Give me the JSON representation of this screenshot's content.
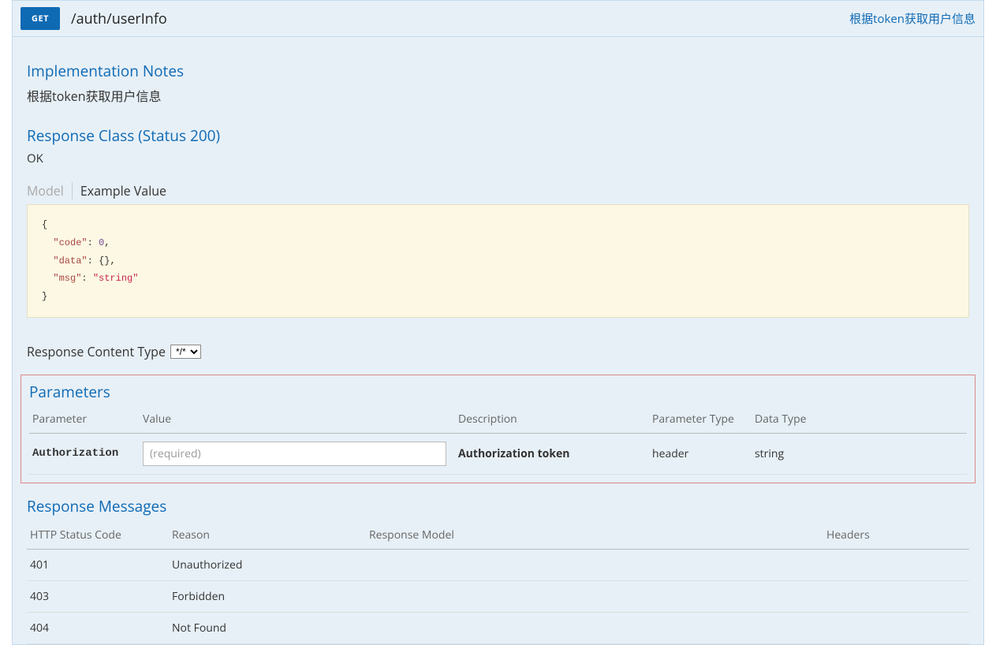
{
  "operation": {
    "method": "GET",
    "path": "/auth/userInfo",
    "summary": "根据token获取用户信息"
  },
  "sections": {
    "impl_notes_title": "Implementation Notes",
    "impl_notes_text": "根据token获取用户信息",
    "response_class_title": "Response Class (Status 200)",
    "response_class_status": "OK",
    "tab_model": "Model",
    "tab_example": "Example Value",
    "example_value": {
      "line1_open": "{",
      "line2_key": "\"code\"",
      "line2_val": "0",
      "line3_key": "\"data\"",
      "line3_val": "{}",
      "line4_key": "\"msg\"",
      "line4_val": "\"string\"",
      "line5_close": "}"
    },
    "response_content_type_label": "Response Content Type",
    "response_content_type_value": "*/*",
    "parameters_title": "Parameters",
    "response_messages_title": "Response Messages"
  },
  "parameters": {
    "headers": {
      "parameter": "Parameter",
      "value": "Value",
      "description": "Description",
      "parameter_type": "Parameter Type",
      "data_type": "Data Type"
    },
    "rows": [
      {
        "name": "Authorization",
        "placeholder": "(required)",
        "value": "",
        "description": "Authorization token",
        "parameter_type": "header",
        "data_type": "string"
      }
    ]
  },
  "response_messages": {
    "headers": {
      "status": "HTTP Status Code",
      "reason": "Reason",
      "model": "Response Model",
      "headers_col": "Headers"
    },
    "rows": [
      {
        "status": "401",
        "reason": "Unauthorized"
      },
      {
        "status": "403",
        "reason": "Forbidden"
      },
      {
        "status": "404",
        "reason": "Not Found"
      }
    ]
  }
}
